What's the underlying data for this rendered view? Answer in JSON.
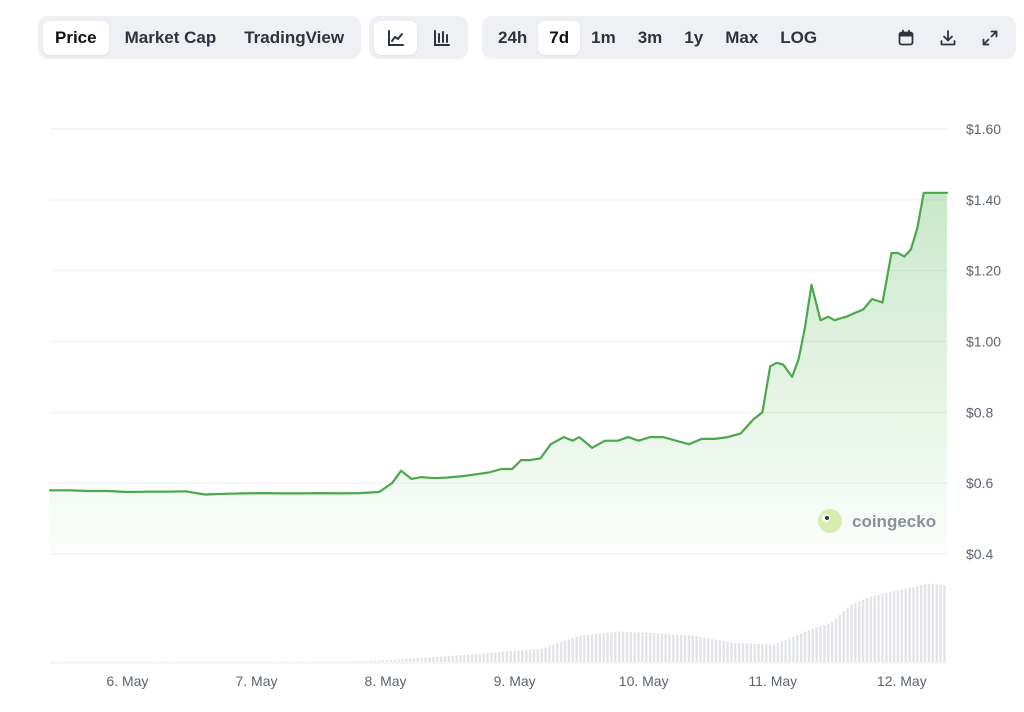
{
  "toolbar": {
    "view_tabs": [
      {
        "label": "Price",
        "active": true
      },
      {
        "label": "Market Cap",
        "active": false
      },
      {
        "label": "TradingView",
        "active": false
      }
    ],
    "chart_type_icons": [
      {
        "icon": "line-chart-icon",
        "active": true
      },
      {
        "icon": "candlestick-chart-icon",
        "active": false
      }
    ],
    "ranges": [
      {
        "label": "24h",
        "active": false
      },
      {
        "label": "7d",
        "active": true
      },
      {
        "label": "1m",
        "active": false
      },
      {
        "label": "3m",
        "active": false
      },
      {
        "label": "1y",
        "active": false
      },
      {
        "label": "Max",
        "active": false
      },
      {
        "label": "LOG",
        "active": false
      }
    ],
    "tool_icons": [
      "calendar-icon",
      "download-icon",
      "fullscreen-icon"
    ]
  },
  "watermark": {
    "text": "coingecko",
    "icon": "gecko-logo-icon"
  },
  "colors": {
    "line": "#4aa84a",
    "fill": "#58b858",
    "volume": "#e3e4e8",
    "grid": "#eceef1",
    "axis_text": "#5c6470"
  },
  "chart_data": {
    "type": "area",
    "title": "",
    "xlabel": "",
    "ylabel": "",
    "ylim": [
      0.4,
      1.6
    ],
    "y_ticks": [
      "$1.60",
      "$1.40",
      "$1.20",
      "$1.00",
      "$0.8",
      "$0.6",
      "$0.4"
    ],
    "y_tick_values": [
      1.6,
      1.4,
      1.2,
      1.0,
      0.8,
      0.6,
      0.4
    ],
    "x_ticks": [
      "6. May",
      "7. May",
      "8. May",
      "9. May",
      "10. May",
      "11. May",
      "12. May"
    ],
    "x_tick_positions": [
      6.0,
      7.0,
      8.0,
      9.0,
      10.0,
      11.0,
      12.0
    ],
    "xlim": [
      5.4,
      12.35
    ],
    "grid": true,
    "series": [
      {
        "x": [
          5.4,
          5.55,
          5.7,
          5.85,
          6.0,
          6.15,
          6.3,
          6.45,
          6.6,
          6.75,
          6.9,
          7.05,
          7.2,
          7.35,
          7.5,
          7.65,
          7.8,
          7.95,
          8.05,
          8.12,
          8.2,
          8.28,
          8.38,
          8.48,
          8.6,
          8.7,
          8.8,
          8.9,
          8.98,
          9.05,
          9.12,
          9.2,
          9.28,
          9.38,
          9.45,
          9.5,
          9.55,
          9.6,
          9.7,
          9.8,
          9.88,
          9.96,
          10.05,
          10.15,
          10.25,
          10.35,
          10.45,
          10.55,
          10.65,
          10.75,
          10.85,
          10.92,
          10.98,
          11.03,
          11.08,
          11.15,
          11.2,
          11.25,
          11.3,
          11.37,
          11.43,
          11.48,
          11.52,
          11.57,
          11.63,
          11.7,
          11.77,
          11.85,
          11.92,
          11.97,
          12.02,
          12.07,
          12.12,
          12.17,
          12.22,
          12.27,
          12.31,
          12.35
        ],
        "y": [
          0.58,
          0.58,
          0.578,
          0.578,
          0.575,
          0.576,
          0.576,
          0.577,
          0.568,
          0.57,
          0.571,
          0.572,
          0.571,
          0.571,
          0.572,
          0.571,
          0.572,
          0.575,
          0.6,
          0.635,
          0.612,
          0.617,
          0.614,
          0.616,
          0.62,
          0.625,
          0.63,
          0.64,
          0.64,
          0.665,
          0.665,
          0.67,
          0.71,
          0.73,
          0.72,
          0.73,
          0.715,
          0.7,
          0.72,
          0.72,
          0.73,
          0.72,
          0.73,
          0.73,
          0.72,
          0.71,
          0.725,
          0.725,
          0.73,
          0.74,
          0.78,
          0.8,
          0.93,
          0.94,
          0.935,
          0.9,
          0.95,
          1.04,
          1.16,
          1.06,
          1.07,
          1.06,
          1.065,
          1.07,
          1.08,
          1.09,
          1.12,
          1.11,
          1.25,
          1.25,
          1.24,
          1.26,
          1.32,
          1.42,
          1.42,
          1.42,
          1.42,
          1.42
        ]
      }
    ],
    "volume": {
      "x": [
        8.0,
        8.3,
        8.6,
        8.9,
        9.2,
        9.5,
        9.8,
        10.1,
        10.4,
        10.7,
        11.0,
        11.15,
        11.3,
        11.45,
        11.6,
        11.75,
        11.9,
        12.05,
        12.2,
        12.35
      ],
      "values": [
        0.02,
        0.05,
        0.08,
        0.12,
        0.15,
        0.3,
        0.35,
        0.33,
        0.3,
        0.22,
        0.2,
        0.28,
        0.38,
        0.45,
        0.65,
        0.75,
        0.8,
        0.85,
        0.9,
        0.88
      ]
    }
  }
}
